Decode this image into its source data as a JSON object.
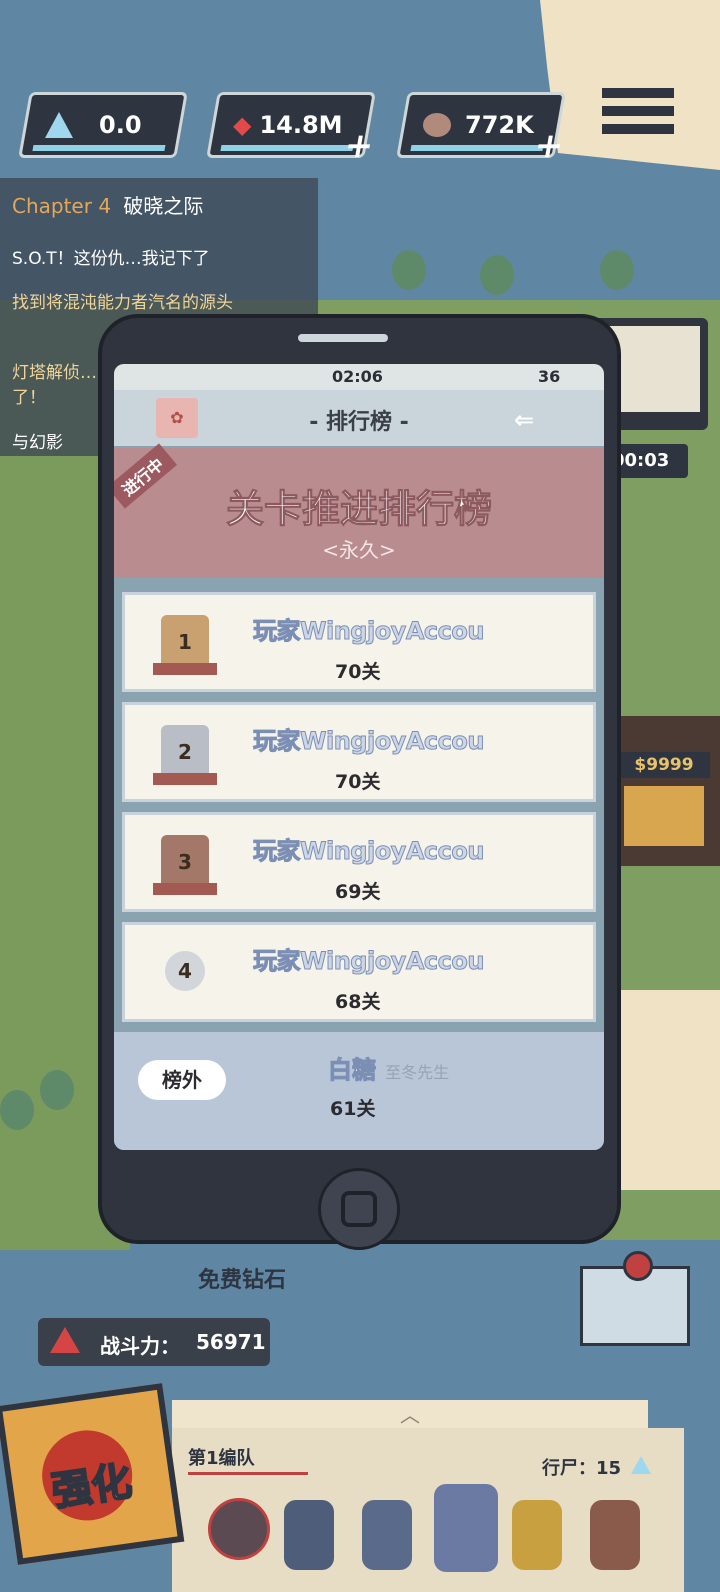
{
  "resources": [
    {
      "icon": "crystal-icon",
      "value": "0.0",
      "plus": false
    },
    {
      "icon": "gem-cluster-icon",
      "value": "14.8M",
      "plus": true
    },
    {
      "icon": "ore-icon",
      "value": "772K",
      "plus": true
    }
  ],
  "quest": {
    "chapter": "Chapter 4",
    "chapter_name": "破晓之际",
    "lines": [
      "S.O.T！这份仇…我记下了",
      "找到将混沌能力者汽名的源头",
      "灯塔解侦…了！",
      "与幻影"
    ]
  },
  "phone": {
    "time": "02:06",
    "battery": "36",
    "title": "- 排行榜 -",
    "banner_tag": "进行中",
    "banner_title": "关卡推进排行榜",
    "banner_sub": "<永久>",
    "ranks": [
      {
        "rank": "1",
        "name": "玩家WingjoyAccou",
        "level": "70关",
        "medal": "gold"
      },
      {
        "rank": "2",
        "name": "玩家WingjoyAccou",
        "level": "70关",
        "medal": "silver"
      },
      {
        "rank": "3",
        "name": "玩家WingjoyAccou",
        "level": "69关",
        "medal": "bronze"
      },
      {
        "rank": "4",
        "name": "玩家WingjoyAccou",
        "level": "68关",
        "medal": "plain"
      }
    ],
    "self": {
      "badge": "榜外",
      "name": "白糖",
      "title": "至冬先生",
      "level": "61关"
    }
  },
  "timer": "00:03",
  "price_sign": "$9999",
  "free_diamond": "免费钻石",
  "power": {
    "label": "战斗力：",
    "value": "56971"
  },
  "boost": "强化",
  "team": {
    "name": "第1编队",
    "zombie_label": "行尸：",
    "zombie_count": "15"
  },
  "colors": {
    "accent": "#b98c8f",
    "resource_bar": "#8fd2e6",
    "panel": "#2f343f"
  }
}
